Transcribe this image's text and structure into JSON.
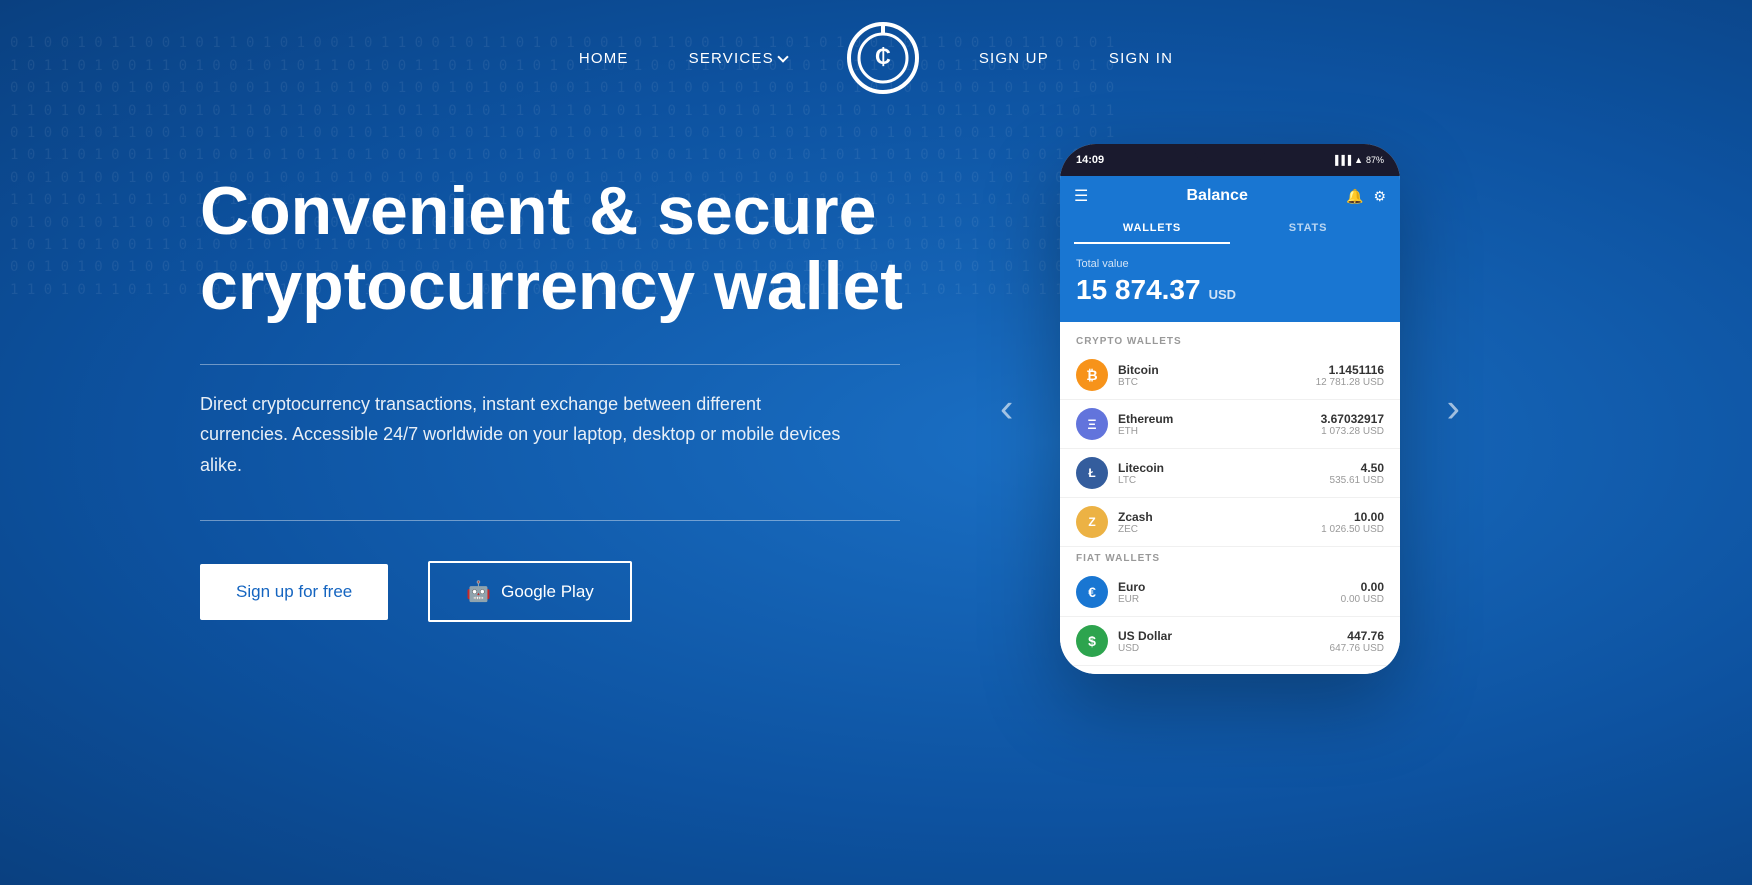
{
  "nav": {
    "home_label": "HOME",
    "services_label": "SERVICES",
    "signup_label": "SIGN UP",
    "signin_label": "SIGN IN"
  },
  "hero": {
    "headline": "Convenient & secure cryptocurrency wallet",
    "subtitle": "Direct cryptocurrency transactions, instant exchange between different currencies. Accessible 24/7 worldwide on your laptop, desktop or mobile devices alike.",
    "cta_signup": "Sign up for free",
    "cta_google_play": "Google Play"
  },
  "phone": {
    "time": "14:09",
    "battery": "87%",
    "header_title": "Balance",
    "tab_wallets": "WALLETS",
    "tab_stats": "STATS",
    "total_value_label": "Total value",
    "total_value": "15 874.37",
    "total_currency": "USD",
    "section_crypto": "CRYPTO WALLETS",
    "section_fiat": "FIAT WALLETS",
    "wallets": [
      {
        "name": "Bitcoin",
        "ticker": "BTC",
        "amount": "1.1451116",
        "usd": "12 781.28 USD",
        "color": "btc"
      },
      {
        "name": "Ethereum",
        "ticker": "ETH",
        "amount": "3.67032917",
        "usd": "1 073.28 USD",
        "color": "eth"
      },
      {
        "name": "Litecoin",
        "ticker": "LTC",
        "amount": "4.50",
        "usd": "535.61 USD",
        "color": "ltc"
      },
      {
        "name": "Zcash",
        "ticker": "ZEC",
        "amount": "10.00",
        "usd": "1 026.50 USD",
        "color": "zec"
      }
    ],
    "fiat_wallets": [
      {
        "name": "Euro",
        "ticker": "EUR",
        "amount": "0.00",
        "usd": "0.00 USD",
        "color": "eur"
      },
      {
        "name": "US Dollar",
        "ticker": "USD",
        "amount": "447.76",
        "usd": "647.76 USD",
        "color": "usd"
      }
    ]
  },
  "carousel": {
    "prev_label": "‹",
    "next_label": "›"
  }
}
